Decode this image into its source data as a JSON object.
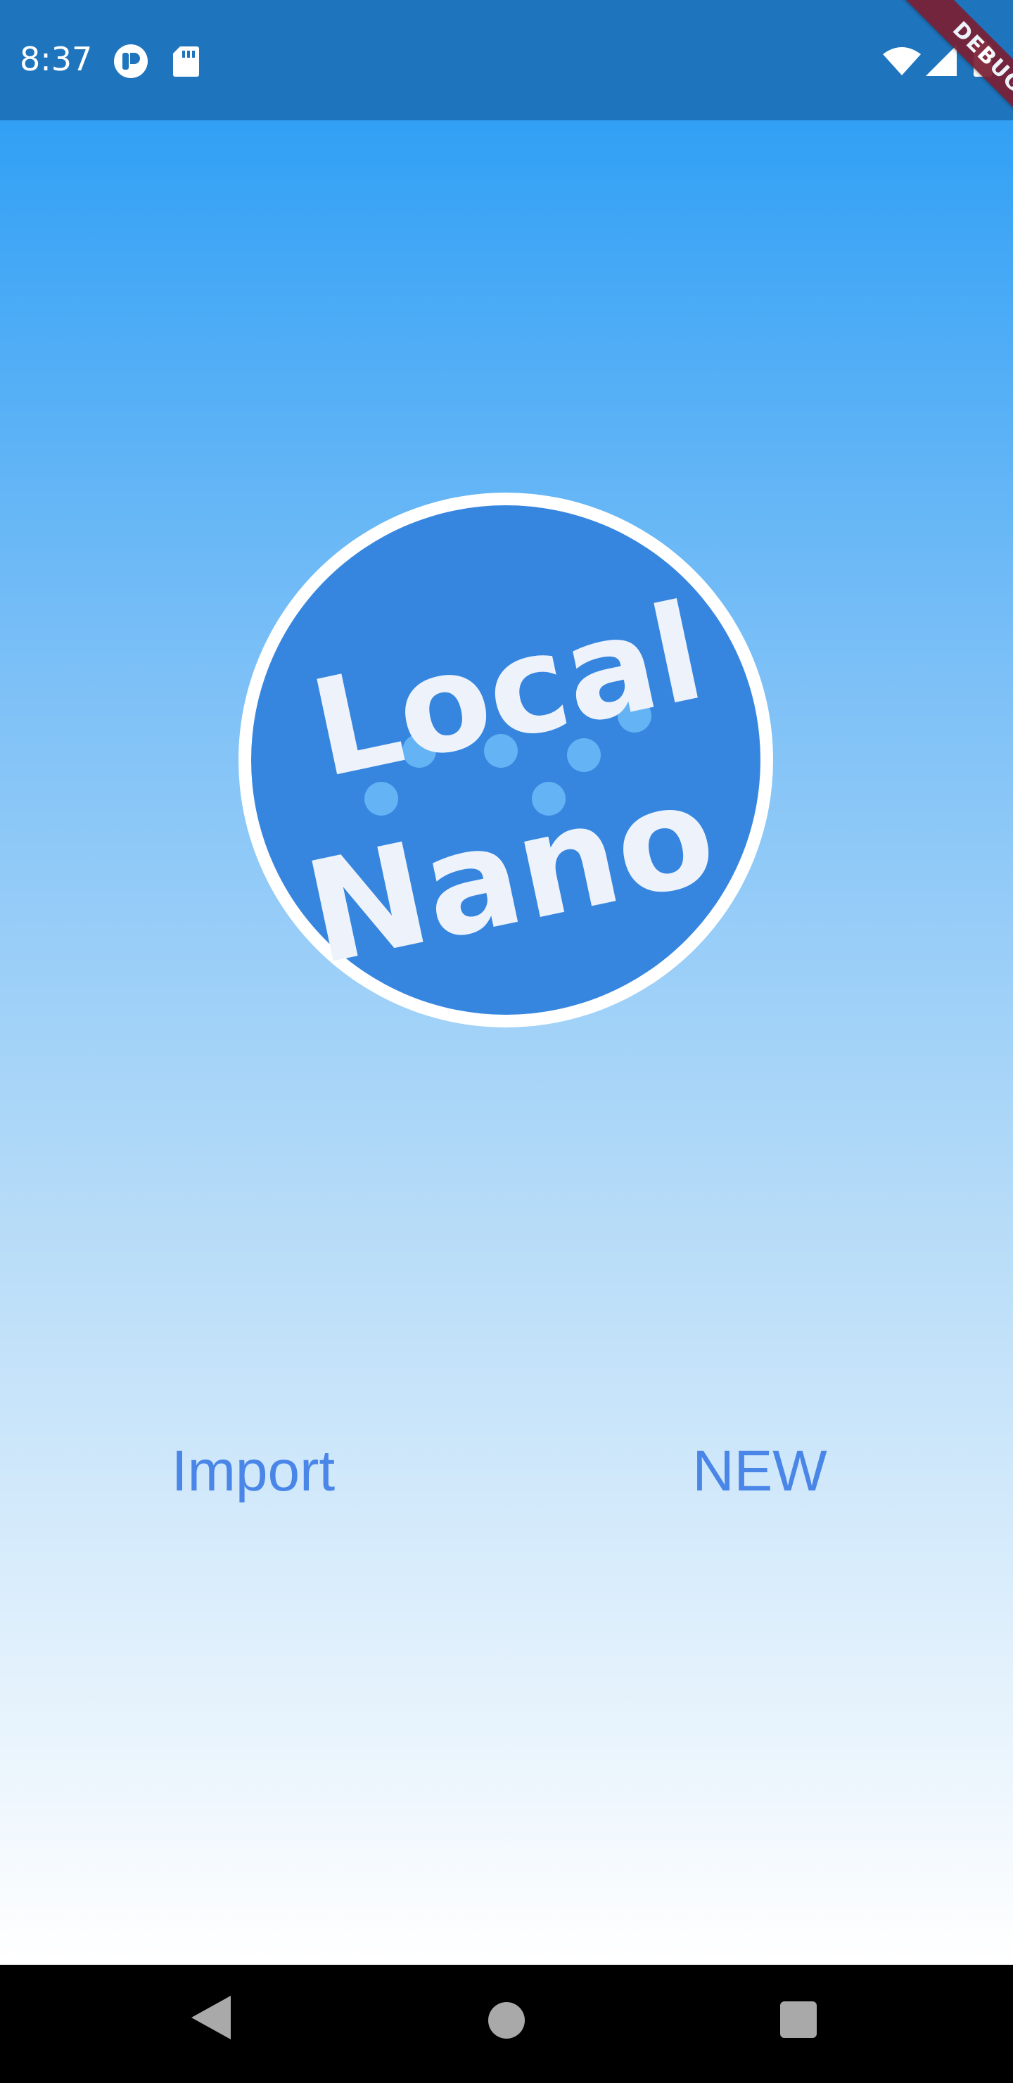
{
  "status_bar": {
    "time": "8:37",
    "icons": [
      "pi-icon",
      "sd-card-icon",
      "wifi-icon",
      "signal-icon",
      "battery-icon"
    ],
    "color": "#1e75bd"
  },
  "debug_banner": {
    "label": "DEBUG",
    "color": "#7a1f33"
  },
  "logo": {
    "line1": "Local",
    "line2": "Nano",
    "circle_color": "#3686e0",
    "ring_color": "#ffffff",
    "text_color": "#eef3fb"
  },
  "actions": {
    "import_label": "Import",
    "new_label": "NEW",
    "accent": "#4a86e8"
  },
  "nav_bar": {
    "icons": [
      "back-icon",
      "home-icon",
      "recents-icon"
    ]
  },
  "theme": {
    "gradient_top": "#31a0f5",
    "gradient_bottom": "#ffffff"
  }
}
